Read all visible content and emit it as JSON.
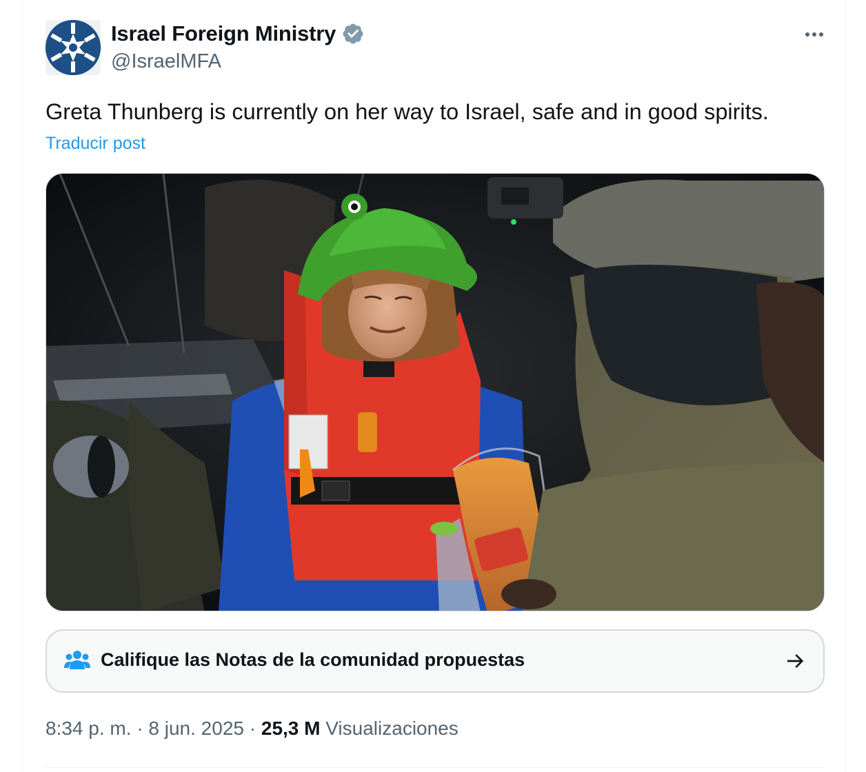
{
  "account": {
    "display_name": "Israel Foreign Ministry",
    "handle": "@IsraelMFA",
    "verified": true,
    "avatar_icon": "israel-mfa-logo",
    "avatar_color": "#1e4f86"
  },
  "tweet": {
    "text": "Greta Thunberg is currently on her way to Israel, safe and in good spirits.",
    "translate_label": "Traducir post",
    "media_icon": "photo"
  },
  "community_notes": {
    "label": "Califique las Notas de la comunidad propuestas",
    "icon": "people-icon",
    "arrow_icon": "arrow-right-icon"
  },
  "meta": {
    "time": "8:34 p. m.",
    "separator1": " · ",
    "date": "8 jun. 2025",
    "separator2": " · ",
    "views_count": "25,3 M",
    "views_label": " Visualizaciones"
  },
  "colors": {
    "text_primary": "#0f1419",
    "text_secondary": "#536471",
    "link": "#1d9bf0",
    "verified_badge": "#829aab",
    "border": "#cfd9de"
  }
}
